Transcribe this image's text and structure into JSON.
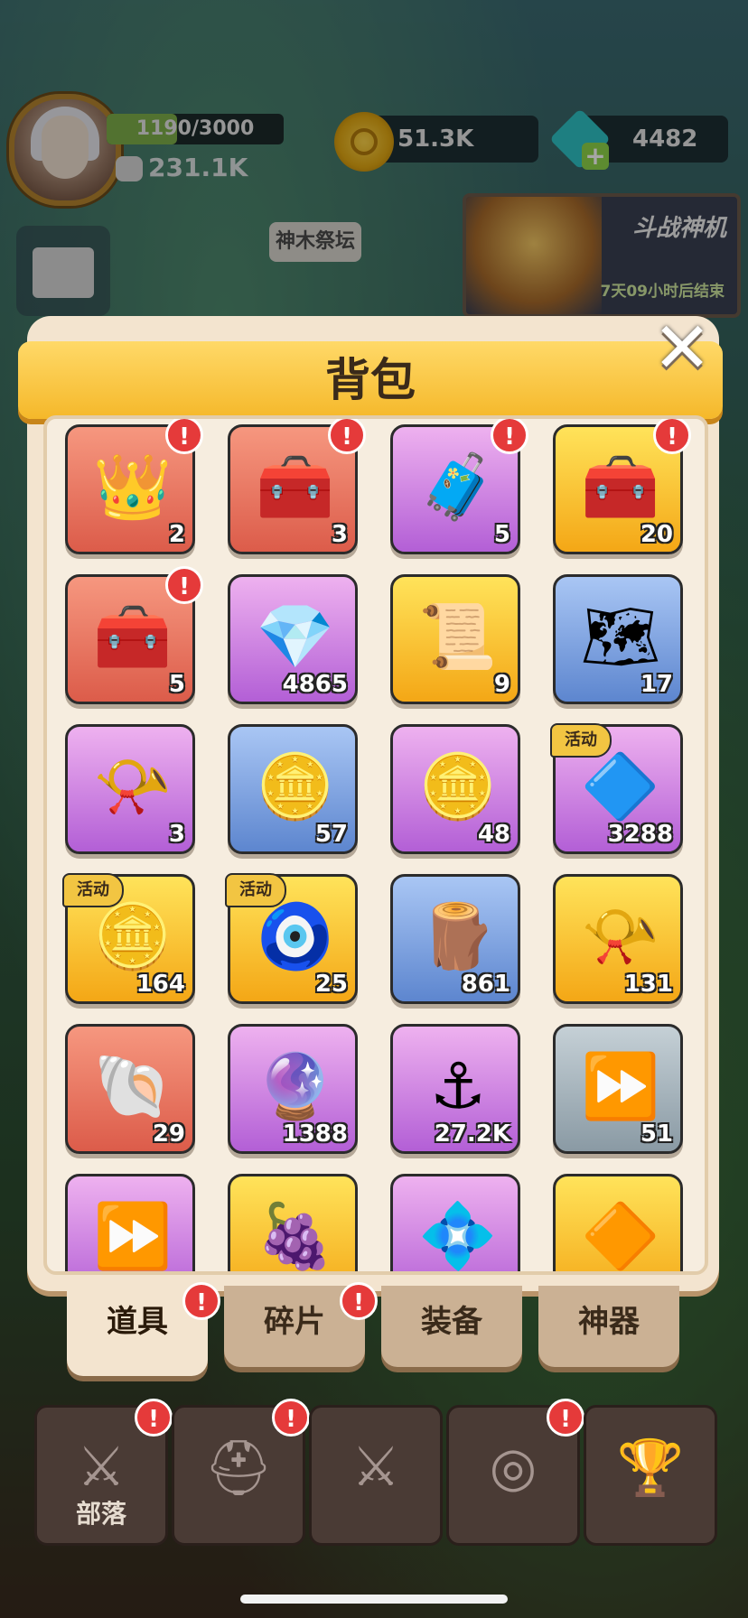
{
  "hud": {
    "xp_text": "1190/3000",
    "xp_fraction": 0.397,
    "power": "231.1K",
    "coins": "51.3K",
    "gems": "4482",
    "gem_plus": "+",
    "altar_label": "神木祭坛",
    "event_title": "斗战神机",
    "event_time": "7天09小时后结束"
  },
  "panel": {
    "title": "背包",
    "close": "✕"
  },
  "items": [
    {
      "icon": "gem-crown-icon",
      "glyph": "👑",
      "rarity": "r-red",
      "count": "2",
      "alert": "!",
      "tag": ""
    },
    {
      "icon": "gold-chest-icon",
      "glyph": "🧰",
      "rarity": "r-red",
      "count": "3",
      "alert": "!",
      "tag": ""
    },
    {
      "icon": "wood-chest-icon",
      "glyph": "🧳",
      "rarity": "r-purple",
      "count": "5",
      "alert": "!",
      "tag": ""
    },
    {
      "icon": "blue-chest-icon",
      "glyph": "🧰",
      "rarity": "r-gold",
      "count": "20",
      "alert": "!",
      "tag": ""
    },
    {
      "icon": "red-chest-icon",
      "glyph": "🧰",
      "rarity": "r-red",
      "count": "5",
      "alert": "!",
      "tag": ""
    },
    {
      "icon": "purple-gem-icon",
      "glyph": "💎",
      "rarity": "r-purple",
      "count": "4865",
      "alert": "",
      "tag": ""
    },
    {
      "icon": "scroll-icon",
      "glyph": "📜",
      "rarity": "r-gold",
      "count": "9",
      "alert": "",
      "tag": ""
    },
    {
      "icon": "map-icon",
      "glyph": "🗺",
      "rarity": "r-blue",
      "count": "17",
      "alert": "",
      "tag": ""
    },
    {
      "icon": "horn-scroll-icon",
      "glyph": "📯",
      "rarity": "r-purple",
      "count": "3",
      "alert": "",
      "tag": ""
    },
    {
      "icon": "silver-coin-icon",
      "glyph": "🪙",
      "rarity": "r-blue",
      "count": "57",
      "alert": "",
      "tag": ""
    },
    {
      "icon": "purple-coin-icon",
      "glyph": "🪙",
      "rarity": "r-purple",
      "count": "48",
      "alert": "",
      "tag": ""
    },
    {
      "icon": "blue-crystal-icon",
      "glyph": "🔷",
      "rarity": "r-purple",
      "count": "3288",
      "alert": "",
      "tag": "活动"
    },
    {
      "icon": "gold-token-icon",
      "glyph": "🪙",
      "rarity": "r-gold",
      "count": "164",
      "alert": "",
      "tag": "活动"
    },
    {
      "icon": "eye-tablet-icon",
      "glyph": "🧿",
      "rarity": "r-gold",
      "count": "25",
      "alert": "",
      "tag": "活动"
    },
    {
      "icon": "wood-logs-icon",
      "glyph": "🪵",
      "rarity": "r-blue",
      "count": "861",
      "alert": "",
      "tag": ""
    },
    {
      "icon": "horn-icon",
      "glyph": "📯",
      "rarity": "r-gold",
      "count": "131",
      "alert": "",
      "tag": ""
    },
    {
      "icon": "pearl-clam-icon",
      "glyph": "🐚",
      "rarity": "r-red",
      "count": "29",
      "alert": "",
      "tag": ""
    },
    {
      "icon": "purple-shards-icon",
      "glyph": "🔮",
      "rarity": "r-purple",
      "count": "1388",
      "alert": "",
      "tag": ""
    },
    {
      "icon": "anchor-coin-icon",
      "glyph": "⚓",
      "rarity": "r-purple",
      "count": "27.2K",
      "alert": "",
      "tag": ""
    },
    {
      "icon": "speed-scroll-icon",
      "glyph": "⏩",
      "rarity": "r-gray",
      "count": "51",
      "alert": "",
      "tag": ""
    },
    {
      "icon": "speed-scroll-purple-icon",
      "glyph": "⏩",
      "rarity": "r-purple",
      "count": "",
      "alert": "",
      "tag": ""
    },
    {
      "icon": "berry-icon",
      "glyph": "🍇",
      "rarity": "r-gold",
      "count": "",
      "alert": "",
      "tag": ""
    },
    {
      "icon": "purple-crystal-icon",
      "glyph": "💠",
      "rarity": "r-purple",
      "count": "",
      "alert": "",
      "tag": ""
    },
    {
      "icon": "gold-crystal-icon",
      "glyph": "🔶",
      "rarity": "r-gold",
      "count": "",
      "alert": "",
      "tag": ""
    }
  ],
  "tabs": [
    {
      "label": "道具",
      "active": true,
      "alert": "!"
    },
    {
      "label": "碎片",
      "active": false,
      "alert": "!"
    },
    {
      "label": "装备",
      "active": false,
      "alert": ""
    },
    {
      "label": "神器",
      "active": false,
      "alert": ""
    }
  ],
  "nav": [
    {
      "icon": "banner-sword-icon",
      "glyph": "⚔",
      "label": "部落",
      "alert": "!"
    },
    {
      "icon": "viking-helmet-icon",
      "glyph": "⛑",
      "label": "",
      "alert": "!"
    },
    {
      "icon": "crossed-swords-icon",
      "glyph": "⚔",
      "label": "",
      "alert": ""
    },
    {
      "icon": "target-icon",
      "glyph": "◎",
      "label": "",
      "alert": "!"
    },
    {
      "icon": "trophy-icon",
      "glyph": "🏆",
      "label": "",
      "alert": ""
    }
  ]
}
